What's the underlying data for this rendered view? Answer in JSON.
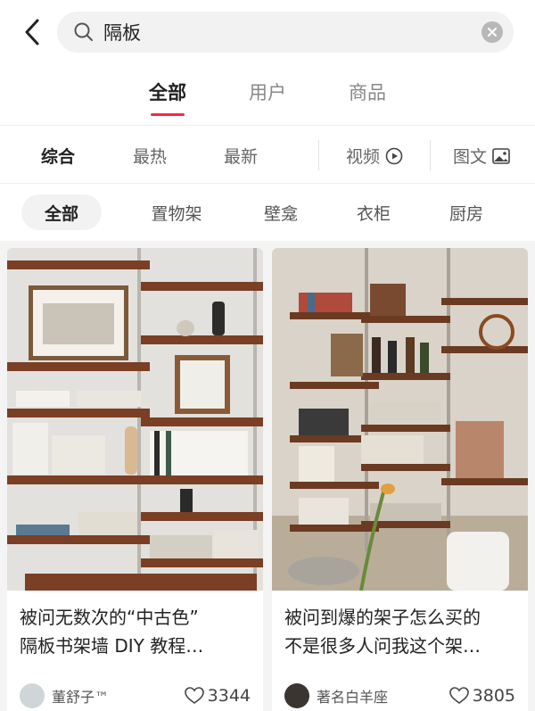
{
  "search": {
    "query": "隔板"
  },
  "tabs": [
    {
      "label": "全部"
    },
    {
      "label": "用户"
    },
    {
      "label": "商品"
    }
  ],
  "sorts": [
    {
      "label": "综合"
    },
    {
      "label": "最热"
    },
    {
      "label": "最新"
    },
    {
      "label": "视频"
    },
    {
      "label": "图文"
    }
  ],
  "chips": [
    {
      "label": "全部"
    },
    {
      "label": "置物架"
    },
    {
      "label": "壁龛"
    },
    {
      "label": "衣柜"
    },
    {
      "label": "厨房"
    }
  ],
  "posts": [
    {
      "title_line1": "被问无数次的“中古色”",
      "title_line2": "隔板书架墙 DIY 教程…",
      "author": "董舒子™",
      "likes": "3344"
    },
    {
      "title_line1": "被问到爆的架子怎么买的",
      "title_line2": "不是很多人问我这个架…",
      "author": "著名白羊座",
      "likes": "3805"
    }
  ],
  "colors": {
    "accent": "#ff2442"
  }
}
